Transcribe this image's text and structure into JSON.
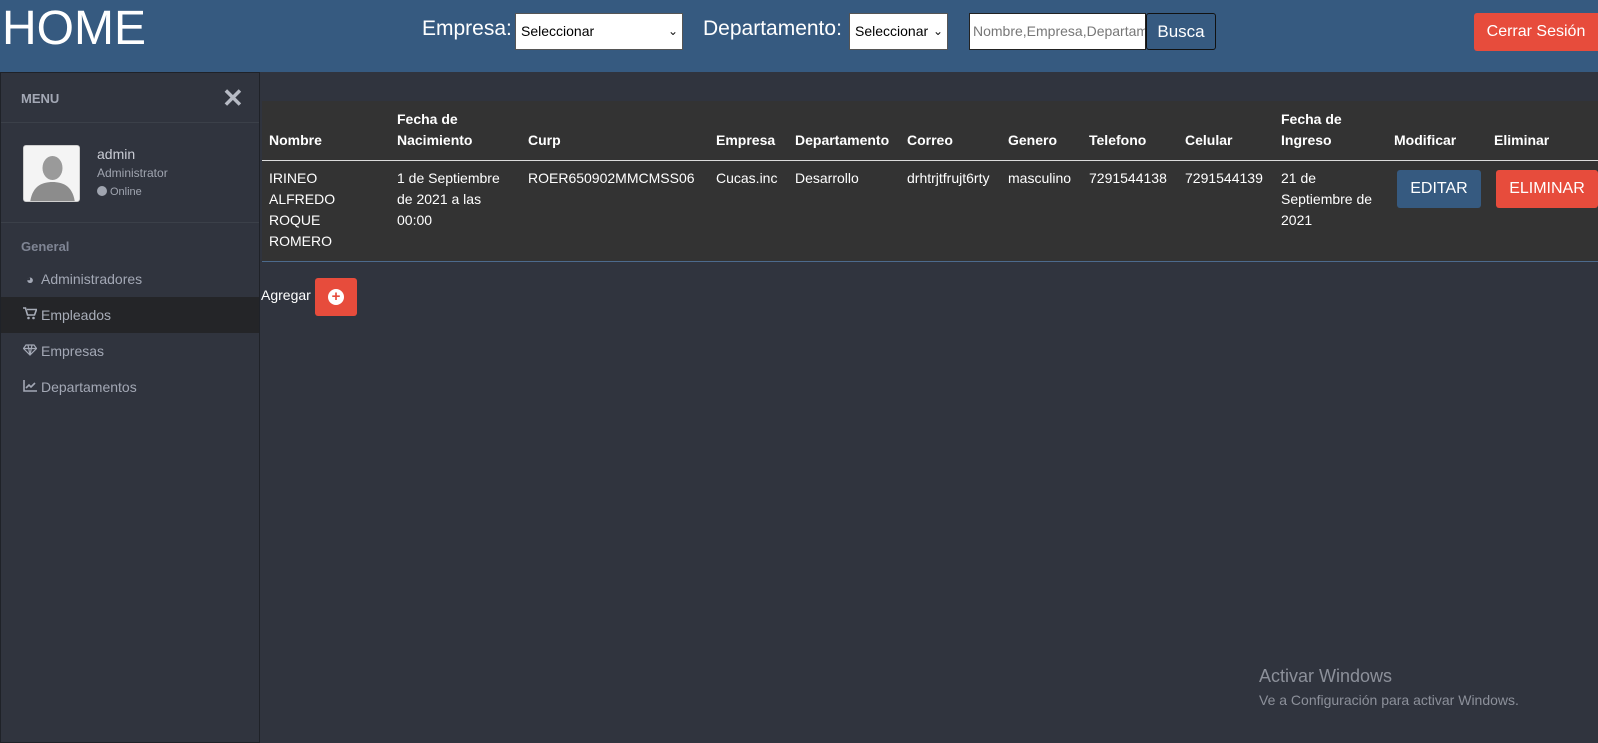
{
  "header": {
    "title": "HOME",
    "empresa_label": "Empresa:",
    "empresa_select": "Seleccionar",
    "departamento_label": "Departamento:",
    "departamento_select": "Seleccionar",
    "search_placeholder": "Nombre,Empresa,Departamento",
    "search_button": "Busca",
    "logout_button": "Cerrar Sesión"
  },
  "sidebar": {
    "menu_title": "MENU",
    "close_icon": "times-icon",
    "user": {
      "name": "admin",
      "role": "Administrator",
      "status": "Online"
    },
    "section": "General",
    "items": [
      {
        "label": "Administradores",
        "icon": "dashboard-icon"
      },
      {
        "label": "Empleados",
        "icon": "shopping-cart-icon",
        "active": true
      },
      {
        "label": "Empresas",
        "icon": "diamond-icon"
      },
      {
        "label": "Departamentos",
        "icon": "line-chart-icon"
      }
    ]
  },
  "table": {
    "headers": [
      "Nombre",
      "Fecha de Nacimiento",
      "Curp",
      "Empresa",
      "Departamento",
      "Correo",
      "Genero",
      "Telefono",
      "Celular",
      "Fecha de Ingreso",
      "Modificar",
      "Eliminar"
    ],
    "rows": [
      {
        "nombre": "IRINEO ALFREDO ROQUE ROMERO",
        "fecha_nacimiento": "1 de Septiembre de 2021 a las 00:00",
        "curp": "ROER650902MMCMSS06",
        "empresa": "Cucas.inc",
        "departamento": "Desarrollo",
        "correo": "drhtrjtfrujt6rty",
        "genero": "masculino",
        "telefono": "7291544138",
        "celular": "7291544139",
        "fecha_ingreso": "21 de Septiembre de 2021",
        "edit_button": "EDITAR",
        "delete_button": "ELIMINAR"
      }
    ]
  },
  "add": {
    "label": "Agregar",
    "icon": "plus-circle-icon"
  },
  "watermark": {
    "title": "Activar Windows",
    "subtitle": "Ve a Configuración para activar Windows."
  },
  "colors": {
    "header": "#365a80",
    "background": "#30343e",
    "danger": "#e74c3c",
    "primary": "#365a80"
  }
}
